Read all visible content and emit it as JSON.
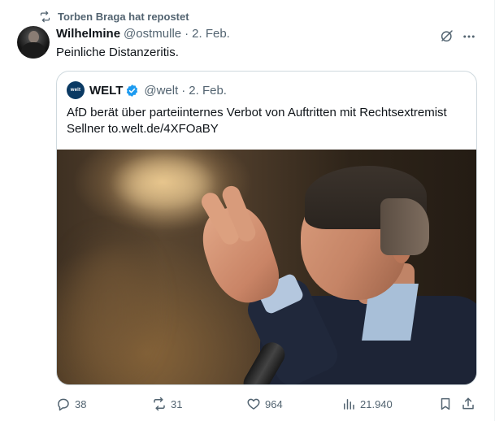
{
  "social_context": {
    "text": "Torben Braga hat repostet"
  },
  "tweet": {
    "author_name": "Wilhelmine",
    "author_handle": "@ostmulle",
    "separator": "·",
    "date": "2. Feb.",
    "text": "Peinliche Distanzeritis."
  },
  "quote": {
    "logo_text": "welt",
    "author_name": "WELT",
    "verified": true,
    "author_handle": "@welt",
    "separator": "·",
    "date": "2. Feb.",
    "text": "AfD berät über parteiinternes Verbot von Auftritten mit Rechtsextremist Sellner to.welt.de/4XFOaBY"
  },
  "actions": {
    "replies": "38",
    "reposts": "31",
    "likes": "964",
    "views": "21.940"
  },
  "colors": {
    "secondary_text": "#536471",
    "primary_text": "#0f1419",
    "border": "#cfd9de",
    "verified_blue": "#1d9bf0",
    "welt_logo_bg": "#0b3a63"
  },
  "icons": [
    "repost-icon",
    "grok-icon",
    "more-icon",
    "verified-icon",
    "reply-icon",
    "like-icon",
    "views-icon",
    "bookmark-icon",
    "share-icon"
  ]
}
